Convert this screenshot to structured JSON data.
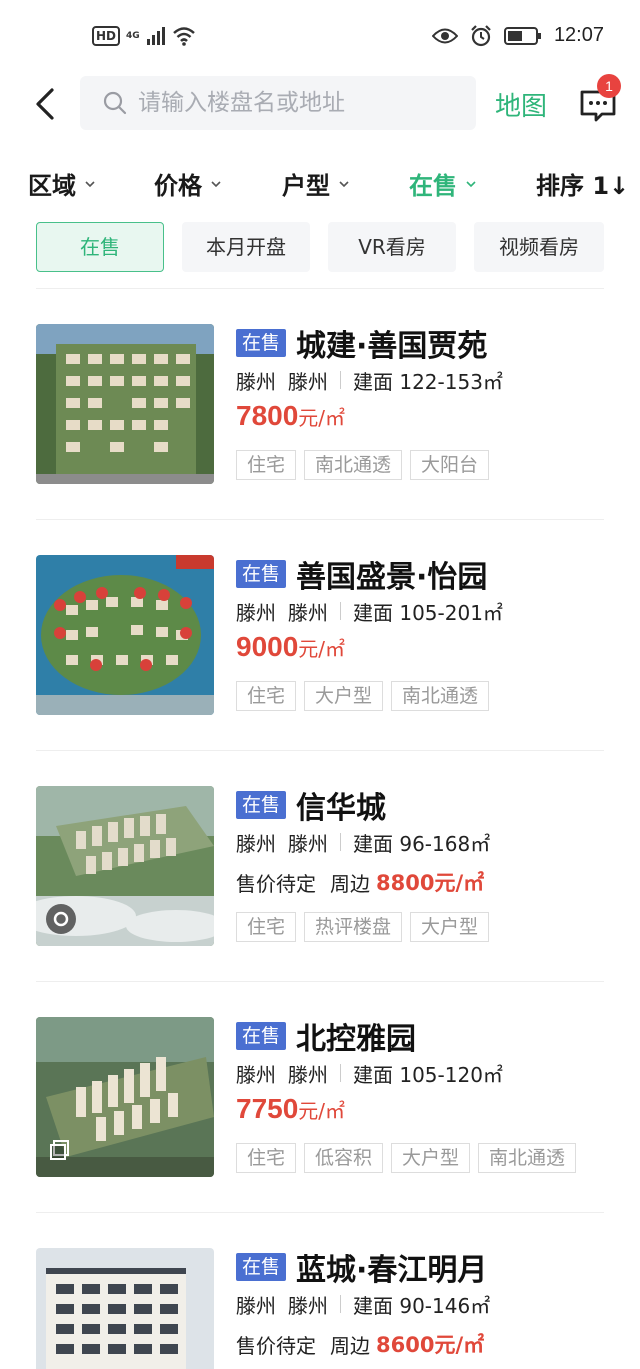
{
  "status_bar": {
    "hd": "HD",
    "network": "4G",
    "time": "12:07"
  },
  "top_bar": {
    "search_placeholder": "请输入楼盘名或地址",
    "map_label": "地图",
    "message_count": "1"
  },
  "filters": [
    {
      "label": "区域",
      "active": false
    },
    {
      "label": "价格",
      "active": false
    },
    {
      "label": "户型",
      "active": false
    },
    {
      "label": "在售",
      "active": true
    },
    {
      "label": "排序 1↓",
      "active": false
    }
  ],
  "chips": [
    {
      "label": "在售",
      "active": true
    },
    {
      "label": "本月开盘",
      "active": false
    },
    {
      "label": "VR看房",
      "active": false
    },
    {
      "label": "视频看房",
      "active": false
    }
  ],
  "colors": {
    "accent_green": "#2fb57a",
    "badge_blue": "#4a6fd1",
    "price_red": "#e0483a"
  },
  "listings": [
    {
      "badge": "在售",
      "name": "城建·善国贾苑",
      "city": "滕州",
      "district": "滕州",
      "area": "建面 122-153㎡",
      "price": "7800",
      "price_unit": "元/㎡",
      "tags": [
        "住宅",
        "南北通透",
        "大阳台"
      ]
    },
    {
      "badge": "在售",
      "name": "善国盛景·怡园",
      "city": "滕州",
      "district": "滕州",
      "area": "建面 105-201㎡",
      "price": "9000",
      "price_unit": "元/㎡",
      "tags": [
        "住宅",
        "大户型",
        "南北通透"
      ]
    },
    {
      "badge": "在售",
      "name": "信华城",
      "city": "滕州",
      "district": "滕州",
      "area": "建面 96-168㎡",
      "pending": "售价待定",
      "near": "周边",
      "price": "8800元/㎡",
      "tags": [
        "住宅",
        "热评楼盘",
        "大户型"
      ],
      "overlay_icon": "vr-icon"
    },
    {
      "badge": "在售",
      "name": "北控雅园",
      "city": "滕州",
      "district": "滕州",
      "area": "建面 105-120㎡",
      "price": "7750",
      "price_unit": "元/㎡",
      "tags": [
        "住宅",
        "低容积",
        "大户型",
        "南北通透"
      ],
      "overlay_icon": "gallery-icon"
    },
    {
      "badge": "在售",
      "name": "蓝城·春江明月",
      "city": "滕州",
      "district": "滕州",
      "area": "建面 90-146㎡",
      "pending": "售价待定",
      "near": "周边",
      "price": "8600元/㎡",
      "tags": []
    }
  ]
}
